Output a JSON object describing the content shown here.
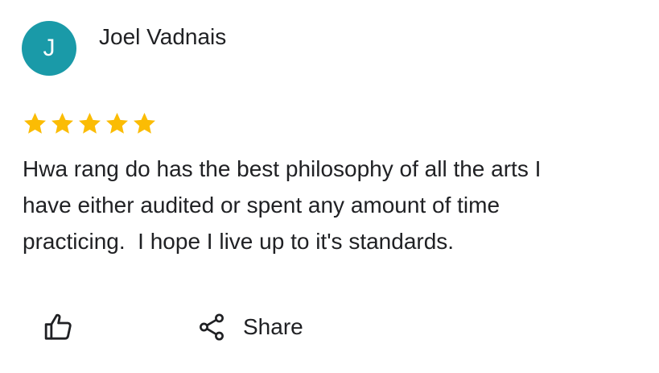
{
  "review": {
    "reviewer": {
      "initial": "J",
      "name": "Joel Vadnais",
      "avatar_color": "#1a9aa8"
    },
    "rating": {
      "stars": 5,
      "max": 5,
      "star_color": "#fbbc04"
    },
    "text": "Hwa rang do has the best philosophy of all the arts I\nhave either audited or spent any amount of time\npracticing.  I hope I live up to it's standards.",
    "actions": {
      "like_icon": "thumb-up-icon",
      "share_icon": "share-icon",
      "share_label": "Share"
    }
  }
}
